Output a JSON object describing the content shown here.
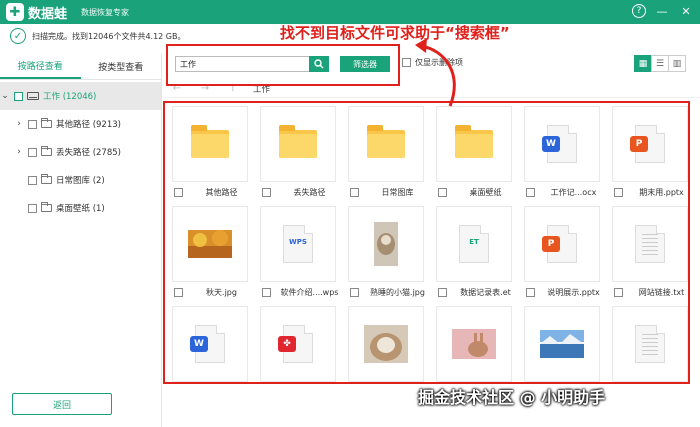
{
  "titlebar": {
    "brand": "数据蛙",
    "subtitle": "数据恢复专家",
    "help": "?",
    "minimize": "—",
    "close": "✕",
    "colors": {
      "accent": "#1aa37a",
      "annotation": "#e0201b"
    }
  },
  "status": {
    "text": "扫描完成。找到12046个文件共4.12 GB。"
  },
  "annotation": {
    "text": "找不到目标文件可求助于“搜索框”"
  },
  "left": {
    "tabs": [
      {
        "label": "按路径查看",
        "active": true
      },
      {
        "label": "按类型查看",
        "active": false
      }
    ],
    "tree": [
      {
        "label": "工作 (12046)",
        "expanded": true,
        "icon": "drive-icon"
      },
      {
        "label": "其他路径 (9213)",
        "icon": "folder-icon"
      },
      {
        "label": "丢失路径 (2785)",
        "icon": "folder-icon"
      },
      {
        "label": "日常图库 (2)",
        "icon": "folder-icon"
      },
      {
        "label": "桌面壁纸 (1)",
        "icon": "folder-icon"
      }
    ],
    "back_label": "返回"
  },
  "toolbar": {
    "search_value": "工作",
    "filter_label": "筛选器",
    "only_deleted_label": "仅显示删除项"
  },
  "nav": {
    "path": "工作"
  },
  "files": [
    {
      "name": "其他路径",
      "kind": "folder"
    },
    {
      "name": "丢失路径",
      "kind": "folder"
    },
    {
      "name": "日常图库",
      "kind": "folder"
    },
    {
      "name": "桌面壁纸",
      "kind": "folder"
    },
    {
      "name": "工作记...ocx",
      "kind": "word"
    },
    {
      "name": "期末用.pptx",
      "kind": "ppt"
    },
    {
      "name": "秋天.jpg",
      "kind": "image-autumn"
    },
    {
      "name": "软件介绍....wps",
      "kind": "wps",
      "badge": "WPS"
    },
    {
      "name": "熟睡的小猫.jpg",
      "kind": "image-cat"
    },
    {
      "name": "数据记录表.et",
      "kind": "et",
      "badge": "ET"
    },
    {
      "name": "说明展示.pptx",
      "kind": "ppt"
    },
    {
      "name": "网站链接.txt",
      "kind": "txt"
    },
    {
      "name": "",
      "kind": "word"
    },
    {
      "name": "",
      "kind": "pdf"
    },
    {
      "name": "",
      "kind": "image-kitten"
    },
    {
      "name": "",
      "kind": "image-rabbit"
    },
    {
      "name": "",
      "kind": "image-lake"
    },
    {
      "name": "",
      "kind": "txt"
    }
  ],
  "watermark": {
    "text": "掘金技术社区 @ 小明助手"
  }
}
